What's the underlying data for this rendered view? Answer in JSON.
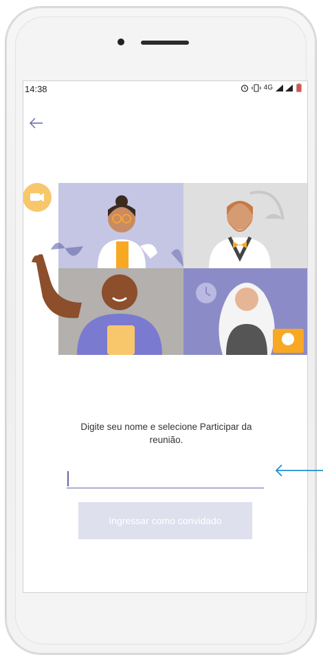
{
  "status_bar": {
    "time": "14:38",
    "network": "4G"
  },
  "join": {
    "prompt": "Digite seu nome e selecione Participar da reunião.",
    "name_value": "",
    "button_label": "Ingressar como convidado"
  },
  "colors": {
    "accent": "#6264a7",
    "button_disabled_bg": "#dfe0ee",
    "callout_arrow": "#1d8fd0"
  },
  "icons": [
    "back-arrow-icon",
    "alarm-icon",
    "vibrate-icon",
    "signal-icon",
    "battery-icon",
    "video-camera-icon"
  ]
}
